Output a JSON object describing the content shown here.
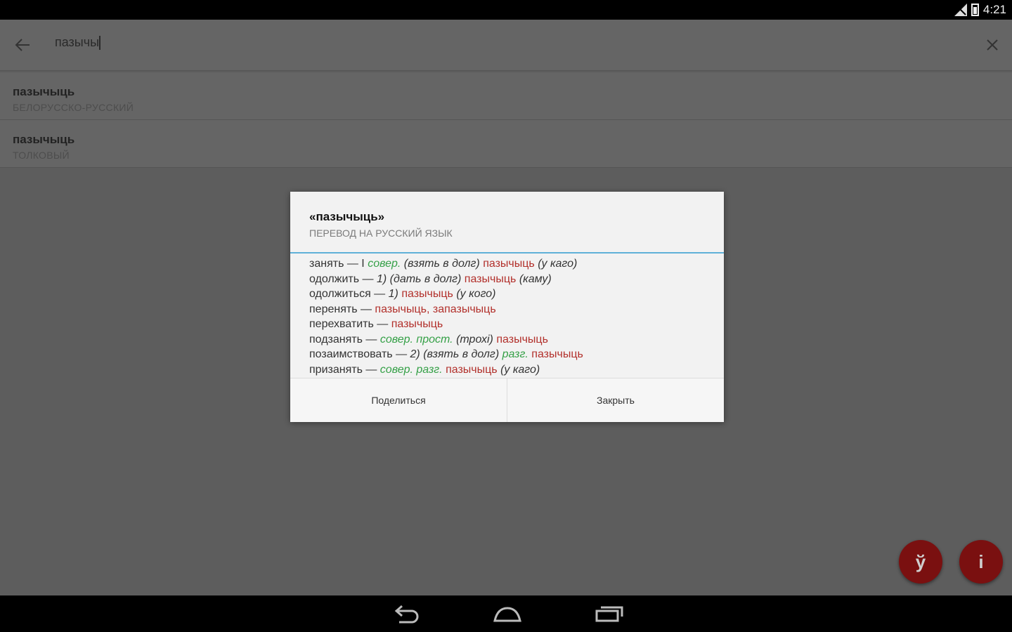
{
  "status_bar": {
    "time": "4:21"
  },
  "search": {
    "value": "пазычы"
  },
  "suggestions": [
    {
      "word": "пазычыць",
      "dictionary": "БЕЛОРУССКО-РУССКИЙ"
    },
    {
      "word": "пазычыць",
      "dictionary": "ТОЛКОВЫЙ"
    }
  ],
  "dialog": {
    "title": "«пазычыць»",
    "subtitle": "ПЕРЕВОД НА РУССКИЙ ЯЗЫК",
    "entries": [
      {
        "term": "занять —",
        "num": "I",
        "label": "совер.",
        "note": "(взять в долг)",
        "translation": "пазычыць",
        "extra": "(у каго)"
      },
      {
        "term": "одолжить —",
        "num": "1)",
        "label": "",
        "note": "(дать в долг)",
        "translation": "пазычыць",
        "extra": "(каму)"
      },
      {
        "term": "одолжиться —",
        "num": "1)",
        "label": "",
        "note": "",
        "translation": "пазычыць",
        "extra": "(у кого)"
      },
      {
        "term": "перенять —",
        "num": "",
        "label": "",
        "note": "",
        "translation": "пазычыць, запазычыць",
        "extra": ""
      },
      {
        "term": "перехватить —",
        "num": "",
        "label": "",
        "note": "",
        "translation": "пазычыць",
        "extra": ""
      },
      {
        "term": "подзанять —",
        "num": "",
        "label": "совер. прост.",
        "note": "(трохі)",
        "translation": "пазычыць",
        "extra": ""
      },
      {
        "term": "позаимствовать —",
        "num": "2)",
        "label": "",
        "note": "(взять в долг)",
        "label2": "разг.",
        "translation": "пазычыць",
        "extra": ""
      },
      {
        "term": "призанять —",
        "num": "",
        "label": "совер. разг.",
        "note": "",
        "translation": "пазычыць",
        "extra": "(у каго)"
      }
    ],
    "share_label": "Поделиться",
    "close_label": "Закрыть"
  },
  "keys": {
    "key1": "ў",
    "key2": "і"
  },
  "colors": {
    "accent_red": "#b2302b",
    "label_green": "#35a047",
    "fab": "#7a1010",
    "divider": "#5fb0d8"
  }
}
